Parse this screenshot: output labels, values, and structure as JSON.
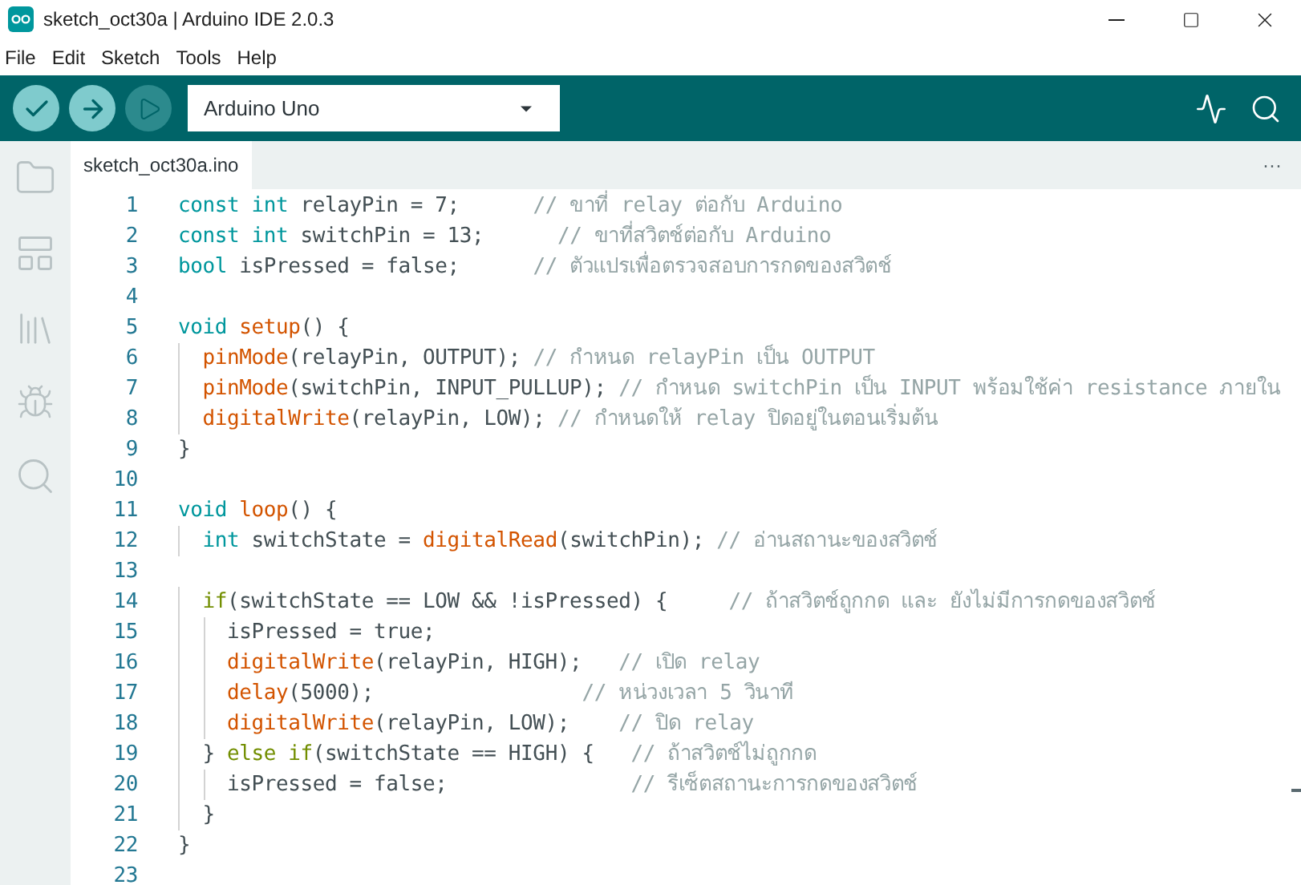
{
  "window": {
    "title": "sketch_oct30a | Arduino IDE 2.0.3"
  },
  "menu": [
    "File",
    "Edit",
    "Sketch",
    "Tools",
    "Help"
  ],
  "toolbar": {
    "board": "Arduino Uno"
  },
  "tabs": [
    {
      "label": "sketch_oct30a.ino",
      "selected": true
    }
  ],
  "tab_overflow": "···",
  "sidebar": [
    {
      "kind": "folder",
      "selected": false
    },
    {
      "kind": "board",
      "selected": false
    },
    {
      "kind": "library",
      "selected": false
    },
    {
      "kind": "debug",
      "selected": false
    },
    {
      "kind": "search",
      "selected": false
    }
  ],
  "editor": {
    "lines": [
      {
        "number": "1",
        "tokens": [
          {
            "kind": "type",
            "text": "const int"
          },
          {
            "kind": "plain",
            "text": " relayPin = 7;      "
          },
          {
            "kind": "comment",
            "text": "// ขาที่ relay ต่อกับ Arduino"
          }
        ]
      },
      {
        "number": "2",
        "tokens": [
          {
            "kind": "type",
            "text": "const int"
          },
          {
            "kind": "plain",
            "text": " switchPin = 13;      "
          },
          {
            "kind": "comment",
            "text": "// ขาที่สวิตช์ต่อกับ Arduino"
          }
        ]
      },
      {
        "number": "3",
        "tokens": [
          {
            "kind": "type",
            "text": "bool"
          },
          {
            "kind": "plain",
            "text": " isPressed = false;      "
          },
          {
            "kind": "comment",
            "text": "// ตัวแปรเพื่อตรวจสอบการกดของสวิตช์"
          }
        ]
      },
      {
        "number": "4"
      },
      {
        "number": "5",
        "tokens": [
          {
            "kind": "type",
            "text": "void"
          },
          {
            "kind": "func",
            "text": " setup"
          },
          {
            "kind": "plain",
            "text": "() {"
          }
        ]
      },
      {
        "number": "6",
        "tokens": [
          {
            "kind": "func",
            "text": "  pinMode"
          },
          {
            "kind": "plain",
            "text": "(relayPin, OUTPUT); "
          },
          {
            "kind": "comment",
            "text": "// กำหนด relayPin เป็น OUTPUT"
          }
        ]
      },
      {
        "number": "7",
        "tokens": [
          {
            "kind": "func",
            "text": "  pinMode"
          },
          {
            "kind": "plain",
            "text": "(switchPin, INPUT_PULLUP); "
          },
          {
            "kind": "comment",
            "text": "// กำหนด switchPin เป็น INPUT พร้อมใช้ค่า resistance ภายใน"
          }
        ]
      },
      {
        "number": "8",
        "tokens": [
          {
            "kind": "func",
            "text": "  digitalWrite"
          },
          {
            "kind": "plain",
            "text": "(relayPin, LOW); "
          },
          {
            "kind": "comment",
            "text": "// กำหนดให้ relay ปิดอยู่ในตอนเริ่มต้น"
          }
        ]
      },
      {
        "number": "9",
        "tokens": [
          {
            "kind": "plain",
            "text": "}"
          }
        ]
      },
      {
        "number": "10"
      },
      {
        "number": "11",
        "tokens": [
          {
            "kind": "type",
            "text": "void"
          },
          {
            "kind": "func",
            "text": " loop"
          },
          {
            "kind": "plain",
            "text": "() {"
          }
        ]
      },
      {
        "number": "12",
        "tokens": [
          {
            "kind": "type",
            "text": "  int"
          },
          {
            "kind": "plain",
            "text": " switchState = "
          },
          {
            "kind": "func",
            "text": "digitalRead"
          },
          {
            "kind": "plain",
            "text": "(switchPin); "
          },
          {
            "kind": "comment",
            "text": "// อ่านสถานะของสวิตช์"
          }
        ]
      },
      {
        "number": "13"
      },
      {
        "number": "14",
        "tokens": [
          {
            "kind": "control",
            "text": "  if"
          },
          {
            "kind": "plain",
            "text": "(switchState == LOW && !isPressed) {     "
          },
          {
            "kind": "comment",
            "text": "// ถ้าสวิตช์ถูกกด และ ยังไม่มีการกดของสวิตช์"
          }
        ]
      },
      {
        "number": "15",
        "tokens": [
          {
            "kind": "plain",
            "text": "    isPressed = true;"
          }
        ]
      },
      {
        "number": "16",
        "tokens": [
          {
            "kind": "func",
            "text": "    digitalWrite"
          },
          {
            "kind": "plain",
            "text": "(relayPin, HIGH);   "
          },
          {
            "kind": "comment",
            "text": "// เปิด relay"
          }
        ]
      },
      {
        "number": "17",
        "tokens": [
          {
            "kind": "func",
            "text": "    delay"
          },
          {
            "kind": "plain",
            "text": "(5000);                 "
          },
          {
            "kind": "comment",
            "text": "// หน่วงเวลา 5 วินาที"
          }
        ]
      },
      {
        "number": "18",
        "tokens": [
          {
            "kind": "func",
            "text": "    digitalWrite"
          },
          {
            "kind": "plain",
            "text": "(relayPin, LOW);    "
          },
          {
            "kind": "comment",
            "text": "// ปิด relay"
          }
        ]
      },
      {
        "number": "19",
        "tokens": [
          {
            "kind": "plain",
            "text": "  } "
          },
          {
            "kind": "control",
            "text": "else if"
          },
          {
            "kind": "plain",
            "text": "(switchState == HIGH) {   "
          },
          {
            "kind": "comment",
            "text": "// ถ้าสวิตช์ไม่ถูกกด"
          }
        ]
      },
      {
        "number": "20",
        "tokens": [
          {
            "kind": "plain",
            "text": "    isPressed = false;               "
          },
          {
            "kind": "comment",
            "text": "// รีเซ็ตสถานะการกดของสวิตช์"
          }
        ]
      },
      {
        "number": "21",
        "tokens": [
          {
            "kind": "plain",
            "text": "  }"
          }
        ]
      },
      {
        "number": "22",
        "tokens": [
          {
            "kind": "plain",
            "text": "}"
          }
        ]
      },
      {
        "number": "23"
      }
    ]
  }
}
